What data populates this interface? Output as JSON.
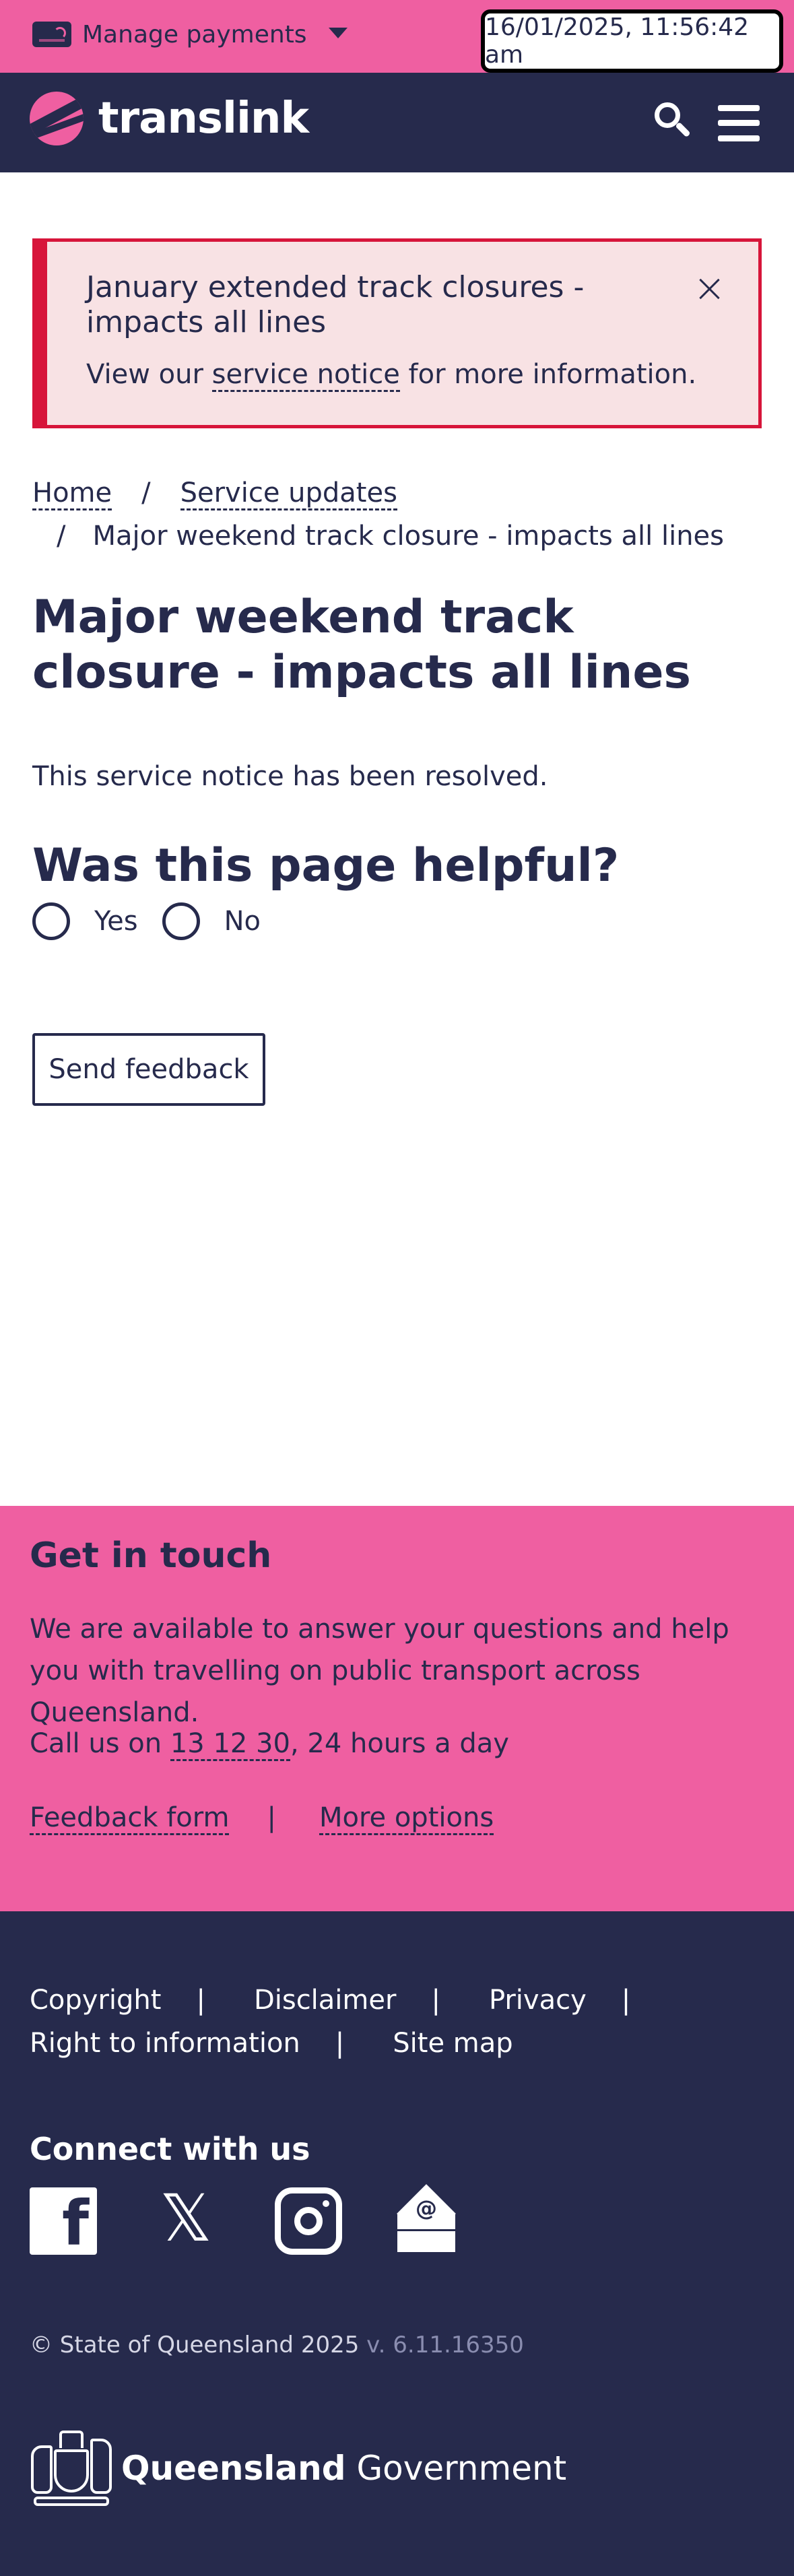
{
  "topbar": {
    "manage_payments": "Manage payments",
    "datetime": "16/01/2025, 11:56:42 am"
  },
  "header": {
    "logo_text": "translink",
    "icons": [
      "search-icon",
      "menu-icon"
    ]
  },
  "alert": {
    "title": "January extended track closures - impacts all lines",
    "body_prefix": "View our ",
    "body_link": "service notice",
    "body_suffix": " for more information."
  },
  "breadcrumb": {
    "home": "Home",
    "separator": "/",
    "service_updates": "Service updates",
    "current": "Major weekend track closure - impacts all lines"
  },
  "main": {
    "title": "Major weekend track closure - impacts all lines",
    "resolved": "This service notice has been resolved.",
    "helpful_title": "Was this page helpful?",
    "yes": "Yes",
    "no": "No",
    "send_feedback": "Send feedback"
  },
  "touch": {
    "title": "Get in touch",
    "description": "We are available to answer your questions and help you with travelling on public transport across Queensland.",
    "call_prefix": "Call us on ",
    "phone": "13 12 30",
    "call_suffix": ", 24 hours a day",
    "feedback_form": "Feedback form",
    "separator": "|",
    "more_options": "More options"
  },
  "footer": {
    "copyright_link": "Copyright",
    "disclaimer": "Disclaimer",
    "privacy": "Privacy",
    "right_to_information": "Right to information",
    "site_map": "Site map",
    "separator": "|",
    "connect_title": "Connect with us",
    "socials": [
      "facebook-icon",
      "x-icon",
      "instagram-icon",
      "email-icon"
    ],
    "copyright_text": "© State of Queensland 2025",
    "version": " v. 6.11.16350",
    "qg_bold": "Queensland",
    "qg_regular": " Government"
  },
  "colors": {
    "pink": "#ef5fa1",
    "navy": "#262a4c",
    "alert_red": "#d7153a",
    "alert_bg": "#f8e2e4"
  }
}
